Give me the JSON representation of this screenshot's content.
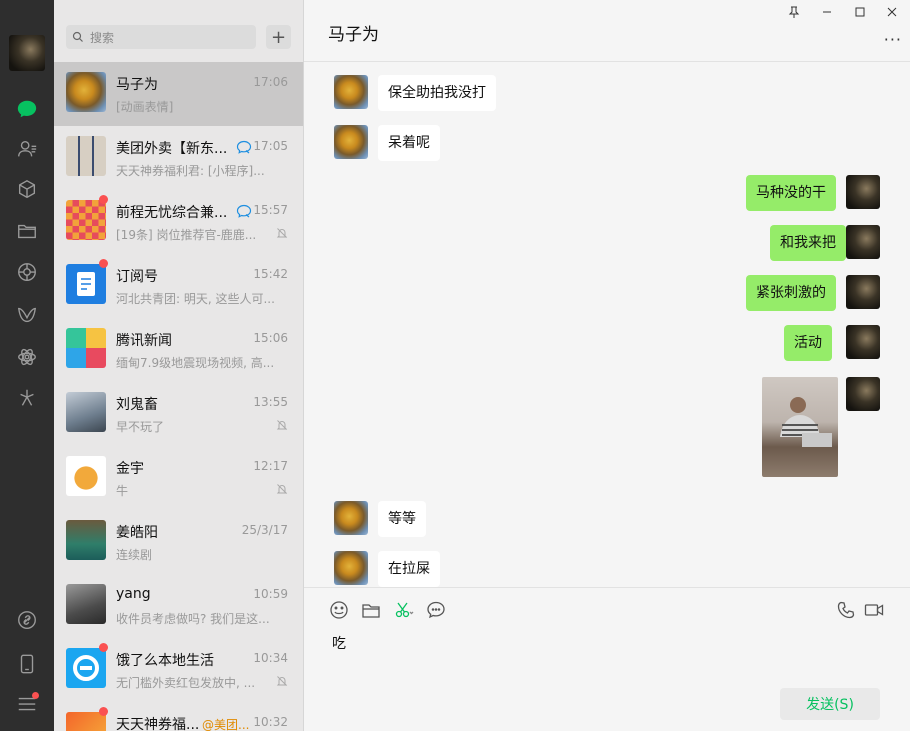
{
  "nav": {
    "badges": [
      "settings"
    ]
  },
  "search": {
    "placeholder": "搜索",
    "add_label": "+"
  },
  "chats": [
    {
      "name": "马子为",
      "time": "17:06",
      "preview": "[动画表情]",
      "active": true,
      "badge": false,
      "muted": false
    },
    {
      "name": "美团外卖【新东...",
      "time": "17:05",
      "preview": "天天神券福利君: [小程序]...",
      "active": false,
      "badge": false,
      "muted": false,
      "mini": true
    },
    {
      "name": "前程无忧综合兼...",
      "time": "15:57",
      "preview": "[19条] 岗位推荐官-鹿鹿...",
      "active": false,
      "badge": true,
      "muted": true,
      "mini": true
    },
    {
      "name": "订阅号",
      "time": "15:42",
      "preview": "河北共青团: 明天, 这些人可...",
      "active": false,
      "badge": true,
      "muted": false
    },
    {
      "name": "腾讯新闻",
      "time": "15:06",
      "preview": "缅甸7.9级地震现场视频, 高...",
      "active": false,
      "badge": false,
      "muted": false
    },
    {
      "name": "刘鬼畜",
      "time": "13:55",
      "preview": "早不玩了",
      "active": false,
      "badge": false,
      "muted": true
    },
    {
      "name": "金宇",
      "time": "12:17",
      "preview": "牛",
      "active": false,
      "badge": false,
      "muted": true
    },
    {
      "name": "姜皓阳",
      "time": "25/3/17",
      "preview": "连续剧",
      "active": false,
      "badge": false,
      "muted": false
    },
    {
      "name": "yang",
      "time": "10:59",
      "preview": "收件员考虑做吗? 我们是这...",
      "active": false,
      "badge": false,
      "muted": false
    },
    {
      "name": "饿了么本地生活",
      "time": "10:34",
      "preview": "无门槛外卖红包发放中, ...",
      "active": false,
      "badge": true,
      "muted": true
    },
    {
      "name": "天天神券福...",
      "time": "10:32",
      "preview": "",
      "active": false,
      "badge": true,
      "muted": false,
      "at": "@美团..."
    }
  ],
  "chat": {
    "title": "马子为",
    "more": "···",
    "messages": [
      {
        "side": "in",
        "text": "保全助拍我没打"
      },
      {
        "side": "in",
        "text": "呆着呢"
      },
      {
        "side": "out",
        "text": "马种没的干"
      },
      {
        "side": "out",
        "text": "和我来把"
      },
      {
        "side": "out",
        "text": "紧张刺激的"
      },
      {
        "side": "out",
        "text": "活动"
      },
      {
        "side": "out",
        "text": "",
        "image": true
      },
      {
        "side": "in",
        "text": "等等"
      },
      {
        "side": "in",
        "text": "在拉屎"
      }
    ],
    "draft": "吃",
    "send_label": "发送(S)"
  },
  "window": {
    "pin": "⊥",
    "minimize": "—",
    "maximize": "☐",
    "close": "✕"
  },
  "colors": {
    "accent": "#07c160",
    "bubble_out": "#95ec69",
    "badge": "#fa5151"
  }
}
